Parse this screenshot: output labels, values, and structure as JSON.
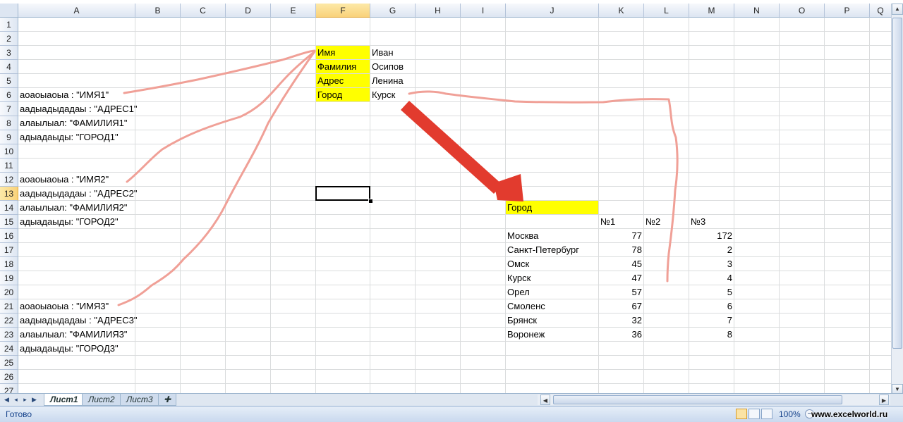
{
  "columns": [
    "A",
    "B",
    "C",
    "D",
    "E",
    "F",
    "G",
    "H",
    "I",
    "J",
    "K",
    "L",
    "M",
    "N",
    "O",
    "P",
    "Q"
  ],
  "rows": [
    "1",
    "2",
    "3",
    "4",
    "5",
    "6",
    "7",
    "8",
    "9",
    "10",
    "11",
    "12",
    "13",
    "14",
    "15",
    "16",
    "17",
    "18",
    "19",
    "20",
    "21",
    "22",
    "23",
    "24",
    "25",
    "26",
    "27"
  ],
  "selected": {
    "column": "F",
    "row": "13"
  },
  "cells": {
    "F3": "Имя",
    "G3": "Иван",
    "F4": "Фамилия",
    "G4": "Осипов",
    "F5": "Адрес",
    "G5": "Ленина",
    "F6": "Город",
    "G6": "Курск",
    "A6": "аоаоыаоыа : \"ИМЯ1\"",
    "A7": "аадыадыдадаы : \"АДРЕС1\"",
    "A8": "алаылыал: \"ФАМИЛИЯ1\"",
    "A9": "адыадаыды: \"ГОРОД1\"",
    "A12": "аоаоыаоыа : \"ИМЯ2\"",
    "A13": "аадыадыдадаы : \"АДРЕС2\"",
    "A14": "алаылыал: \"ФАМИЛИЯ2\"",
    "A15": "адыадаыды: \"ГОРОД2\"",
    "A21": "аоаоыаоыа : \"ИМЯ3\"",
    "A22": "аадыадыдадаы : \"АДРЕС3\"",
    "A23": "алаылыал: \"ФАМИЛИЯ3\"",
    "A24": "адыадаыды: \"ГОРОД3\"",
    "J14": "Город",
    "K15": "№1",
    "L15": "№2",
    "M15": "№3"
  },
  "city_table": [
    {
      "city": "Москва",
      "n1": "77",
      "n3": "172"
    },
    {
      "city": "Санкт-Петербург",
      "n1": "78",
      "n3": "2"
    },
    {
      "city": "Омск",
      "n1": "45",
      "n3": "3"
    },
    {
      "city": "Курск",
      "n1": "47",
      "n3": "4"
    },
    {
      "city": "Орел",
      "n1": "57",
      "n3": "5"
    },
    {
      "city": "Смоленс",
      "n1": "67",
      "n3": "6"
    },
    {
      "city": "Брянск",
      "n1": "32",
      "n3": "7"
    },
    {
      "city": "Воронеж",
      "n1": "36",
      "n3": "8"
    }
  ],
  "sheet_tabs": [
    "Лист1",
    "Лист2",
    "Лист3"
  ],
  "status": {
    "ready": "Готово",
    "zoom": "100%",
    "zoom_minus": "−"
  },
  "watermark": "www.excelworld.ru",
  "colors": {
    "highlight": "#ffff00",
    "annotation_line": "#f0a097",
    "arrow": "#e23b2e"
  }
}
